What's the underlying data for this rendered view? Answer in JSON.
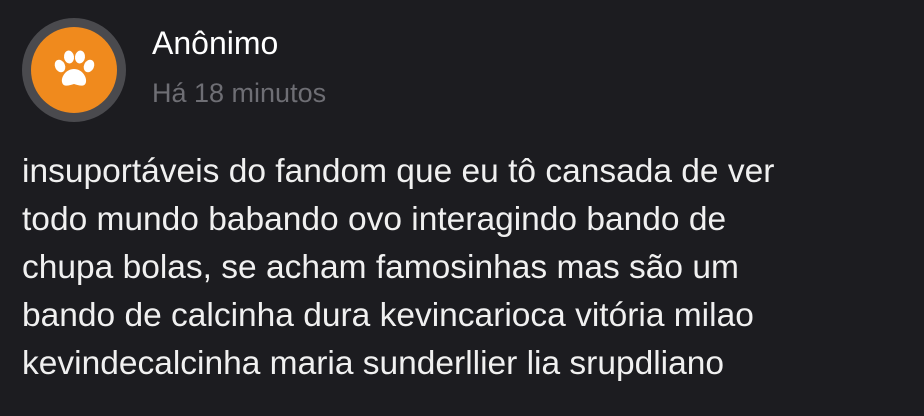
{
  "post": {
    "author": "Anônimo",
    "timestamp": "Há 18 minutos",
    "avatar_icon": "paw-icon",
    "avatar_color": "#f08a1d",
    "lines": [
      "insuportáveis do fandom que eu tô cansada de ver",
      "todo mundo babando ovo interagindo bando de",
      "chupa bolas, se acham famosinhas mas são um",
      "bando de calcinha dura kevincarioca vitória milao",
      "kevindecalcinha maria sunderllier lia srupdliano"
    ]
  }
}
